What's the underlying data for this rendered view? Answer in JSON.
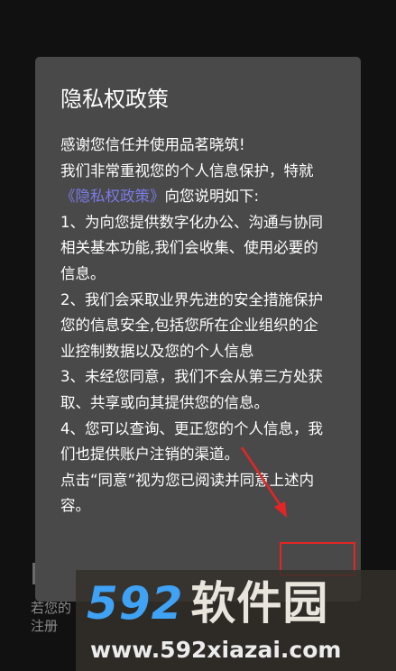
{
  "background": {
    "line1": "若您的",
    "line2": "注册"
  },
  "dialog": {
    "title": "隐私权政策",
    "line_thanks": "感谢您信任并使用品茗晓筑!",
    "line_intro": "我们非常重视您的个人信息保护，特就",
    "policy_link": "《隐私权政策》",
    "line_intro_end": "向您说明如下:",
    "item1_a": "1、为向您提供数字化办公、沟通与协同",
    "item1_b": "相关基本功能,我们会收集、使用必要的",
    "item1_c": "信息。",
    "item2_a": "2、我们会采取业界先进的安全措施保护",
    "item2_b": "您的信息安全,包括您所在企业组织的企",
    "item2_c": "业控制数据以及您的个人信息",
    "item3_a": "3、未经您同意，我们不会从第三方处获",
    "item3_b": "取、共享或向其提供您的信息。",
    "item4_a": "4、您可以查询、更正您的个人信息，我",
    "item4_b": "们也提供账户注销的渠道。",
    "consent_a": "点击“同意”视为您已阅读并同意上述内",
    "consent_b": "容。"
  },
  "watermark": {
    "logo_number": "592",
    "logo_text": "软件园",
    "url": "www.592xiazai.com"
  },
  "colors": {
    "dialog_bg": "#494949",
    "link": "#7b7be8",
    "highlight": "#e52525",
    "logo_blue": "#3fa2f5"
  }
}
